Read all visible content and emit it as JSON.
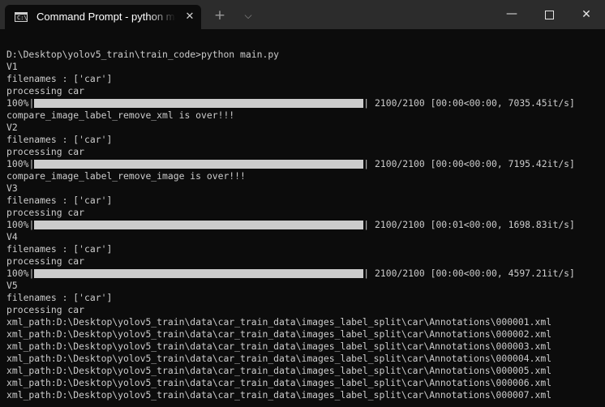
{
  "window": {
    "tab_title": "Command Prompt - python  main.py",
    "tab_icon": "cmd-icon",
    "close_tab_glyph": "✕",
    "new_tab_glyph": "+",
    "dropdown_glyph": "⌵",
    "minimize_glyph": "—",
    "close_glyph": "✕"
  },
  "console": {
    "lines": [
      "D:\\Desktop\\yolov5_train\\train_code>python main.py",
      "V1",
      "filenames : ['car']",
      "processing car",
      "",
      "compare_image_label_remove_xml is over!!!",
      "V2",
      "filenames : ['car']",
      "processing car",
      "",
      "compare_image_label_remove_image is over!!!",
      "V3",
      "filenames : ['car']",
      "processing car",
      "",
      "V4",
      "filenames : ['car']",
      "processing car",
      "",
      "V5",
      "filenames : ['car']",
      "processing car",
      "xml_path:D:\\Desktop\\yolov5_train\\data\\car_train_data\\images_label_split\\car\\Annotations\\000001.xml",
      "xml_path:D:\\Desktop\\yolov5_train\\data\\car_train_data\\images_label_split\\car\\Annotations\\000002.xml",
      "xml_path:D:\\Desktop\\yolov5_train\\data\\car_train_data\\images_label_split\\car\\Annotations\\000003.xml",
      "xml_path:D:\\Desktop\\yolov5_train\\data\\car_train_data\\images_label_split\\car\\Annotations\\000004.xml",
      "xml_path:D:\\Desktop\\yolov5_train\\data\\car_train_data\\images_label_split\\car\\Annotations\\000005.xml",
      "xml_path:D:\\Desktop\\yolov5_train\\data\\car_train_data\\images_label_split\\car\\Annotations\\000006.xml",
      "xml_path:D:\\Desktop\\yolov5_train\\data\\car_train_data\\images_label_split\\car\\Annotations\\000007.xml"
    ],
    "progress": [
      {
        "line_index": 4,
        "percent_label": "100%",
        "fraction": 1.0,
        "tail": "2100/2100 [00:00<00:00, 7035.45it/s]"
      },
      {
        "line_index": 9,
        "percent_label": "100%",
        "fraction": 1.0,
        "tail": "2100/2100 [00:00<00:00, 7195.42it/s]"
      },
      {
        "line_index": 14,
        "percent_label": "100%",
        "fraction": 1.0,
        "tail": "2100/2100 [00:01<00:00, 1698.83it/s]"
      },
      {
        "line_index": 18,
        "percent_label": "100%",
        "fraction": 1.0,
        "tail": "2100/2100 [00:00<00:00, 4597.21it/s]"
      }
    ]
  },
  "colors": {
    "console_bg": "#0c0c0c",
    "console_fg": "#cccccc",
    "titlebar_bg": "#2c2c2c"
  }
}
